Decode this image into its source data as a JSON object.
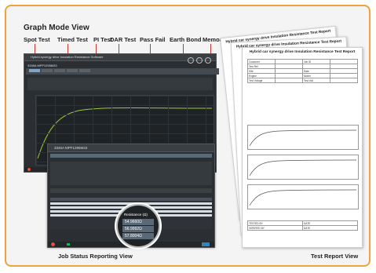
{
  "title": "Graph Mode View",
  "features": [
    "Spot Test",
    "Timed Test",
    "PI Test",
    "DAR Test",
    "Pass Fail",
    "Earth Bond",
    "Memory"
  ],
  "graph_window": {
    "app_title": "Hybrid synergy drive Insulation Resistance Software",
    "label": "3345A MPF1295M33"
  },
  "job_window": {
    "label": "3345A  MPF1295M33"
  },
  "magnifier": {
    "header": "Resistance (Ω)",
    "values": [
      "54.9660Ω",
      "56.9992Ω",
      "57.8004Ω"
    ]
  },
  "report": {
    "titles": [
      "Hybrid car synergy drive Insulation Resistance Test Report",
      "Hybrid car synergy drive Insulation Resistance Test Report",
      "Hybrid car synergy drive Insulation Resistance Test Report"
    ],
    "rows": [
      [
        "Customer",
        "",
        "Job ID",
        ""
      ],
      [
        "Test Ref",
        "",
        "",
        ""
      ],
      [
        "Site",
        "",
        "Date",
        ""
      ],
      [
        "Engine",
        "",
        "Model",
        ""
      ],
      [
        "Test Voltage",
        "",
        "Test Volt",
        ""
      ]
    ],
    "labels": {
      "tested_by": "TESTED BY",
      "verified_by": "VERIFIED BY",
      "date": "DATE"
    }
  },
  "captions": {
    "job": "Job Status Reporting View",
    "report": "Test Report View"
  },
  "colors": {
    "frame": "#f0a23b",
    "connector": "#c0392b",
    "window_bg": "#2b2f33"
  }
}
